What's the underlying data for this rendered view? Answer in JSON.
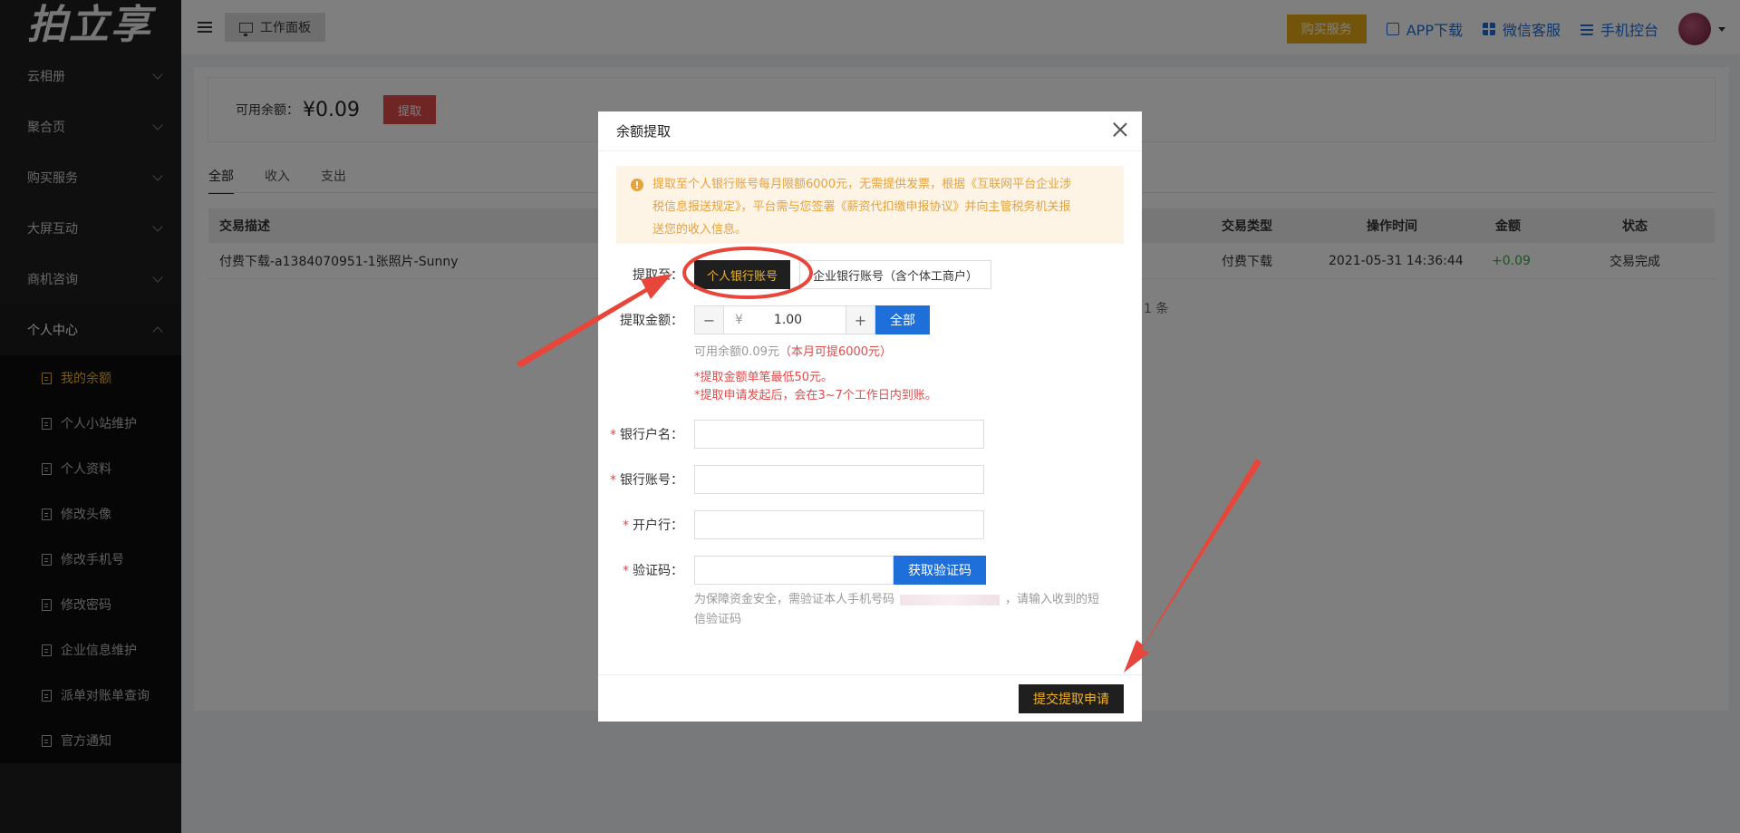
{
  "sidebar": {
    "logo": "拍立享",
    "groups": [
      {
        "label": "云相册"
      },
      {
        "label": "聚合页"
      },
      {
        "label": "购买服务"
      },
      {
        "label": "大屏互动"
      },
      {
        "label": "商机咨询"
      },
      {
        "label": "个人中心"
      }
    ],
    "sub_items": [
      {
        "label": "我的余额"
      },
      {
        "label": "个人小站维护"
      },
      {
        "label": "个人资料"
      },
      {
        "label": "修改头像"
      },
      {
        "label": "修改手机号"
      },
      {
        "label": "修改密码"
      },
      {
        "label": "企业信息维护"
      },
      {
        "label": "派单对账单查询"
      },
      {
        "label": "官方通知"
      }
    ]
  },
  "topbar": {
    "workpanel": "工作面板",
    "buy": "购买服务",
    "app_download": "APP下载",
    "wechat_service": "微信客服",
    "mobile_console": "手机控台"
  },
  "balance": {
    "label": "可用余额：",
    "value": "¥0.09",
    "withdraw": "提取"
  },
  "tabs": [
    "全部",
    "收入",
    "支出"
  ],
  "table": {
    "headers": {
      "desc": "交易描述",
      "type": "交易类型",
      "time": "操作时间",
      "amount": "金额",
      "status": "状态"
    },
    "row": {
      "desc": "付费下载-a1384070951-1张照片-Sunny",
      "type": "付费下载",
      "time": "2021-05-31 14:36:44",
      "amount": "+0.09",
      "status": "交易完成"
    },
    "count_fragment": "1 条"
  },
  "modal": {
    "title": "余额提取",
    "notice_line1": "提取至个人银行账号每月限额6000元，无需提供发票，根据《互联网平台企业涉",
    "notice_line2": "税信息报送规定》，平台需与您签署《薪资代扣缴申报协议》并向主管税务机关报",
    "notice_line3": "送您的收入信息。",
    "withdraw_to_label": "提取至：",
    "option_personal": "个人银行账号",
    "option_company": "企业银行账号（含个体工商户）",
    "amount_label": "提取金额：",
    "currency": "¥",
    "amount_value": "1.00",
    "all_button": "全部",
    "available_hint": "可用余额0.09元",
    "monthly_hint": "（本月可提6000元）",
    "min_rule": "*提取金额单笔最低50元。",
    "arrival_rule": "*提取申请发起后，会在3~7个工作日内到账。",
    "account_name_label": "银行户名：",
    "account_no_label": "银行账号：",
    "bank_label": "开户行：",
    "code_label": "验证码：",
    "get_code_button": "获取验证码",
    "verify_hint_a": "为保障资金安全，需验证本人手机号码",
    "verify_hint_b": "，请输入收到的短",
    "verify_hint_c": "信验证码",
    "submit_button": "提交提取申请"
  },
  "colors": {
    "accent_gold": "#f0b429",
    "primary_blue": "#1e6fd9",
    "danger_red": "#e04b4b",
    "annotation_red": "#e8463a"
  }
}
